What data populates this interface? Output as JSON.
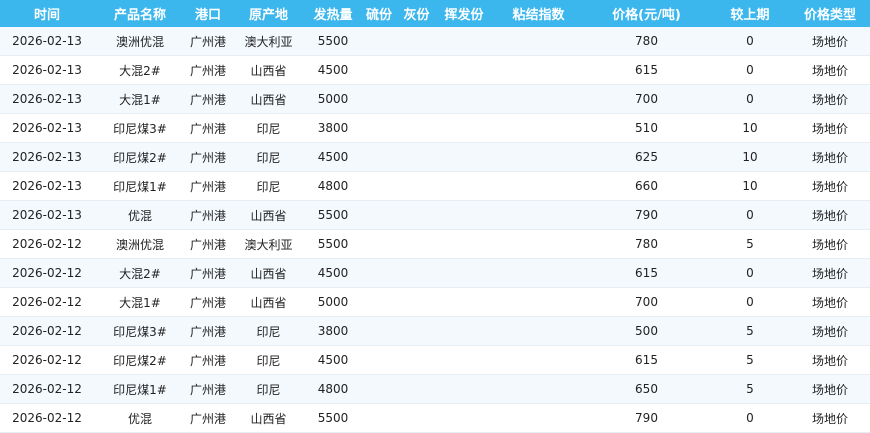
{
  "table": {
    "headers": [
      "时间",
      "产品名称",
      "港口",
      "原产地",
      "发热量",
      "硫份",
      "灰份",
      "挥发份",
      "粘结指数",
      "价格(元/吨)",
      "较上期",
      "价格类型"
    ],
    "rows": [
      [
        "2026-02-13",
        "澳洲优混",
        "广州港",
        "澳大利亚",
        "5500",
        "",
        "",
        "",
        "",
        "780",
        "0",
        "场地价"
      ],
      [
        "2026-02-13",
        "大混2#",
        "广州港",
        "山西省",
        "4500",
        "",
        "",
        "",
        "",
        "615",
        "0",
        "场地价"
      ],
      [
        "2026-02-13",
        "大混1#",
        "广州港",
        "山西省",
        "5000",
        "",
        "",
        "",
        "",
        "700",
        "0",
        "场地价"
      ],
      [
        "2026-02-13",
        "印尼煤3#",
        "广州港",
        "印尼",
        "3800",
        "",
        "",
        "",
        "",
        "510",
        "10",
        "场地价"
      ],
      [
        "2026-02-13",
        "印尼煤2#",
        "广州港",
        "印尼",
        "4500",
        "",
        "",
        "",
        "",
        "625",
        "10",
        "场地价"
      ],
      [
        "2026-02-13",
        "印尼煤1#",
        "广州港",
        "印尼",
        "4800",
        "",
        "",
        "",
        "",
        "660",
        "10",
        "场地价"
      ],
      [
        "2026-02-13",
        "优混",
        "广州港",
        "山西省",
        "5500",
        "",
        "",
        "",
        "",
        "790",
        "0",
        "场地价"
      ],
      [
        "2026-02-12",
        "澳洲优混",
        "广州港",
        "澳大利亚",
        "5500",
        "",
        "",
        "",
        "",
        "780",
        "5",
        "场地价"
      ],
      [
        "2026-02-12",
        "大混2#",
        "广州港",
        "山西省",
        "4500",
        "",
        "",
        "",
        "",
        "615",
        "0",
        "场地价"
      ],
      [
        "2026-02-12",
        "大混1#",
        "广州港",
        "山西省",
        "5000",
        "",
        "",
        "",
        "",
        "700",
        "0",
        "场地价"
      ],
      [
        "2026-02-12",
        "印尼煤3#",
        "广州港",
        "印尼",
        "3800",
        "",
        "",
        "",
        "",
        "500",
        "5",
        "场地价"
      ],
      [
        "2026-02-12",
        "印尼煤2#",
        "广州港",
        "印尼",
        "4500",
        "",
        "",
        "",
        "",
        "615",
        "5",
        "场地价"
      ],
      [
        "2026-02-12",
        "印尼煤1#",
        "广州港",
        "印尼",
        "4800",
        "",
        "",
        "",
        "",
        "650",
        "5",
        "场地价"
      ],
      [
        "2026-02-12",
        "优混",
        "广州港",
        "山西省",
        "5500",
        "",
        "",
        "",
        "",
        "790",
        "0",
        "场地价"
      ]
    ]
  }
}
